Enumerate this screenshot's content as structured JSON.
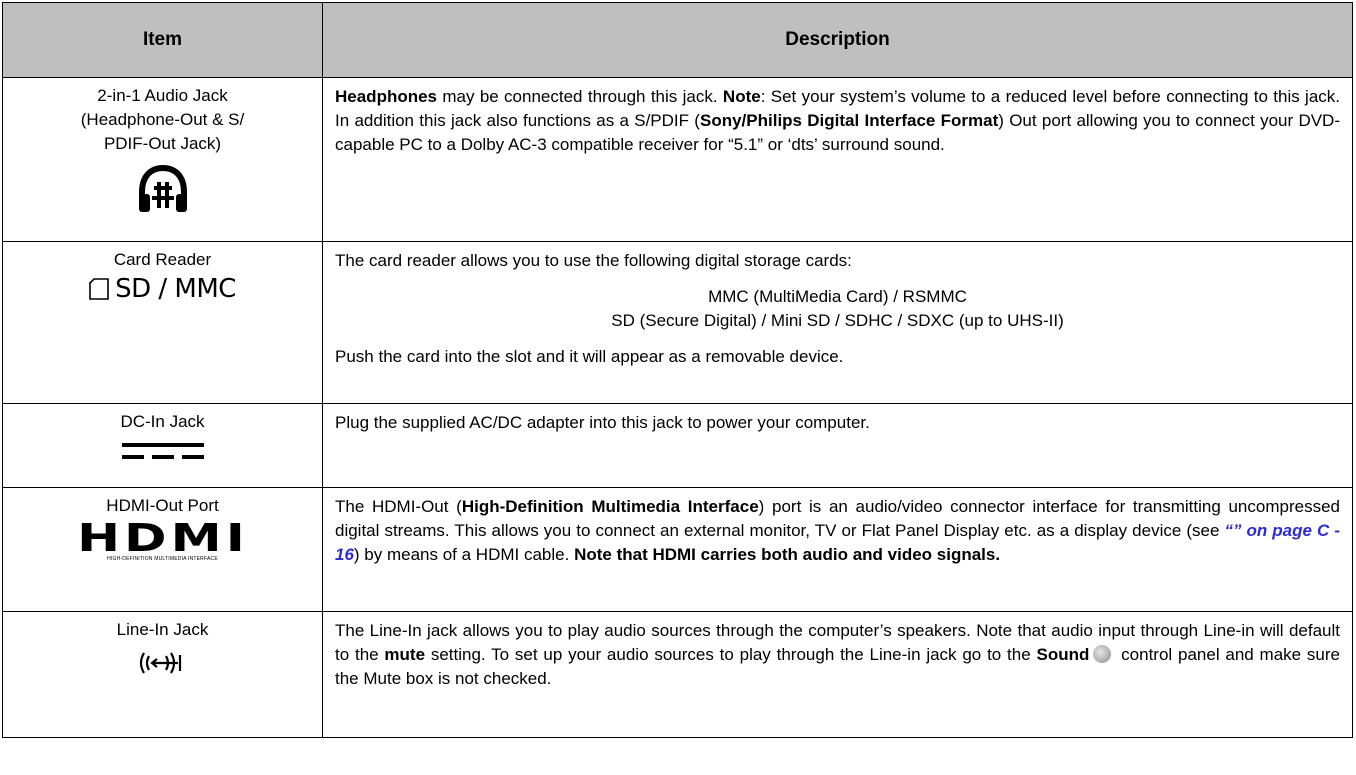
{
  "header": {
    "item": "Item",
    "description": "Description"
  },
  "rows": [
    {
      "item_lines": [
        "2-in-1 Audio Jack",
        "(Headphone-Out & S/",
        "PDIF-Out Jack)"
      ],
      "icon": "headphone-spdif-icon",
      "desc": {
        "b1": "Headphones",
        "t1": " may be connected through this jack. ",
        "b2": "Note",
        "t2": ": Set your system’s volume to a reduced level before connecting to this jack. In addition this jack also functions as a S/PDIF (",
        "b3": "Sony/Philips Digital Interface Format",
        "t3": ") Out port allowing you to connect your DVD-capable PC to a Dolby AC-3 compatible receiver for “5.1” or ‘dts’ surround sound."
      }
    },
    {
      "item_lines": [
        "Card Reader"
      ],
      "icon": "card-reader-icon",
      "icon_text": "SD / MMC",
      "desc": {
        "intro": "The card reader allows you to use the following digital storage cards:",
        "cards": [
          "MMC (MultiMedia Card) / RSMMC",
          "SD (Secure Digital) / Mini SD / SDHC / SDXC (up to UHS-II)"
        ],
        "outro": "Push the card into the slot and it will appear as a removable device."
      }
    },
    {
      "item_lines": [
        "DC-In Jack"
      ],
      "icon": "dc-in-icon",
      "desc": {
        "t1": "Plug the supplied AC/DC adapter into this jack to power your computer."
      }
    },
    {
      "item_lines": [
        "HDMI-Out Port"
      ],
      "icon": "hdmi-logo-icon",
      "icon_text": "HDMI",
      "icon_subtext": "HIGH-DEFINITION MULTIMEDIA INTERFACE",
      "desc": {
        "t1": "The HDMI-Out (",
        "b1": "High-Definition Multimedia Interface",
        "t2": ") port is an audio/video connector interface for transmitting uncompressed digital streams. This allows you to connect an external monitor, TV or Flat Panel Display etc. as a display device (see ",
        "link": "“” on page C - 16",
        "t3": ") by means of a HDMI cable. ",
        "b2": "Note that HDMI carries both audio and video signals."
      }
    },
    {
      "item_lines": [
        "Line-In Jack"
      ],
      "icon": "line-in-icon",
      "desc": {
        "t1": "The Line-In jack allows you to play audio sources through the computer’s speakers. Note that audio input through Line-in will default to the ",
        "b1": "mute",
        "t2": " setting. To set up your audio sources to play through the Line-in jack go to the ",
        "b2": "Sound",
        "sound_icon": "sound-icon",
        "t3": " control panel and make sure the Mute box is not checked."
      }
    }
  ]
}
